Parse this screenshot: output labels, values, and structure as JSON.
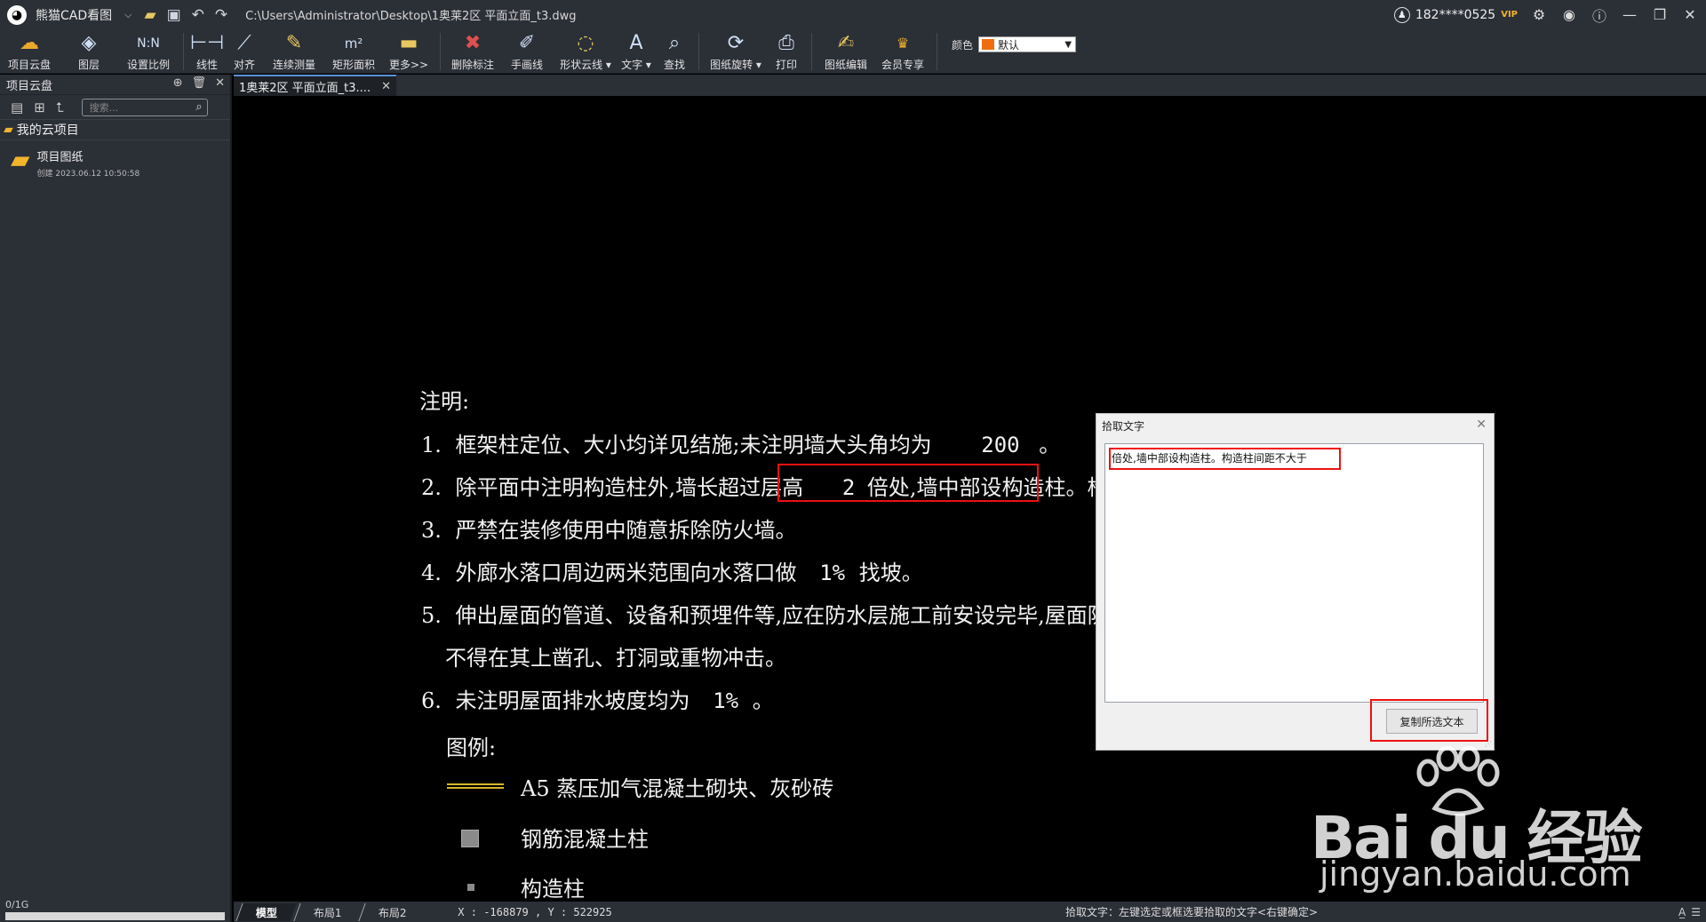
{
  "app": {
    "name": "熊猫CAD看图",
    "file_path": "C:\\Users\\Administrator\\Desktop\\1奥莱2区  平面立面_t3.dwg",
    "user": "182****0525",
    "vip_badge": "VIP"
  },
  "ribbon": {
    "items": [
      {
        "label": "项目云盘",
        "icon": "cloud-icon"
      },
      {
        "label": "图层",
        "icon": "layers-icon"
      },
      {
        "label": "设置比例",
        "icon": "scale-icon"
      },
      {
        "label": "线性",
        "icon": "linear-measure-icon"
      },
      {
        "label": "对齐",
        "icon": "aligned-measure-icon"
      },
      {
        "label": "连续测量",
        "icon": "continuous-measure-icon"
      },
      {
        "label": "矩形面积",
        "icon": "area-icon"
      },
      {
        "label": "更多>>",
        "icon": "ruler-icon"
      },
      {
        "label": "删除标注",
        "icon": "delete-dim-icon"
      },
      {
        "label": "手画线",
        "icon": "pen-icon"
      },
      {
        "label": "形状云线",
        "icon": "cloud-shape-icon"
      },
      {
        "label": "文字",
        "icon": "text-icon"
      },
      {
        "label": "查找",
        "icon": "find-icon"
      },
      {
        "label": "图纸旋转",
        "icon": "rotate-icon"
      },
      {
        "label": "打印",
        "icon": "print-icon"
      },
      {
        "label": "图纸编辑",
        "icon": "edit-drawing-icon"
      },
      {
        "label": "会员专享",
        "icon": "vip-icon"
      }
    ],
    "color_label": "颜色",
    "color_value": "默认",
    "color_swatch": "#f06d0f"
  },
  "sidebar": {
    "title": "项目云盘",
    "search_placeholder": "搜索...",
    "root_label": "我的云项目",
    "items": [
      {
        "name": "项目图纸",
        "date": "创建 2023.06.12 10:50:58"
      }
    ],
    "storage": "0/1G"
  },
  "document_tab": {
    "label": "1奥莱2区  平面立面_t3...."
  },
  "drawing": {
    "heading": "注明:",
    "notes": [
      {
        "num": "1.",
        "text": "框架柱定位、大小均详见结施;未注明墙大头角均为",
        "value": "200",
        "tail": "。"
      },
      {
        "num": "2.",
        "text": "除平面中注明构造柱外,墙长超过层高",
        "value": "2",
        "tail": "倍处,墙中部设构造柱。构造柱间距不大于"
      },
      {
        "num": "3.",
        "text": "严禁在装修使用中随意拆除防火墙。"
      },
      {
        "num": "4.",
        "text": "外廊水落口周边两米范围向水落口做",
        "value": "1%",
        "tail": "找坡。"
      },
      {
        "num": "5.",
        "text": "伸出屋面的管道、设备和预埋件等,应在防水层施工前安设完毕,屋面防水层施工后"
      },
      {
        "num": "",
        "text": "不得在其上凿孔、打洞或重物冲击。"
      },
      {
        "num": "6.",
        "text": "未注明屋面排水坡度均为",
        "value": "1%",
        "tail": "。"
      }
    ],
    "legend_title": "图例:",
    "legend": [
      {
        "label": "A5 蒸压加气混凝土砌块、灰砂砖",
        "color": "#d4b72a"
      },
      {
        "label": "钢筋混凝土柱"
      },
      {
        "label": "构造柱"
      }
    ]
  },
  "dialog": {
    "title": "拾取文字",
    "picked_text": "倍处,墙中部设构造柱。构造柱间距不大于",
    "copy_button": "复制所选文本"
  },
  "statusbar": {
    "tabs": [
      "模型",
      "布局1",
      "布局2"
    ],
    "coords": "X : -168879 , Y : 522925",
    "message": "拾取文字：左键选定或框选要拾取的文字<右键确定>"
  },
  "watermark": {
    "brand": "Bai du 经验",
    "url": "jingyan.baidu.com"
  }
}
